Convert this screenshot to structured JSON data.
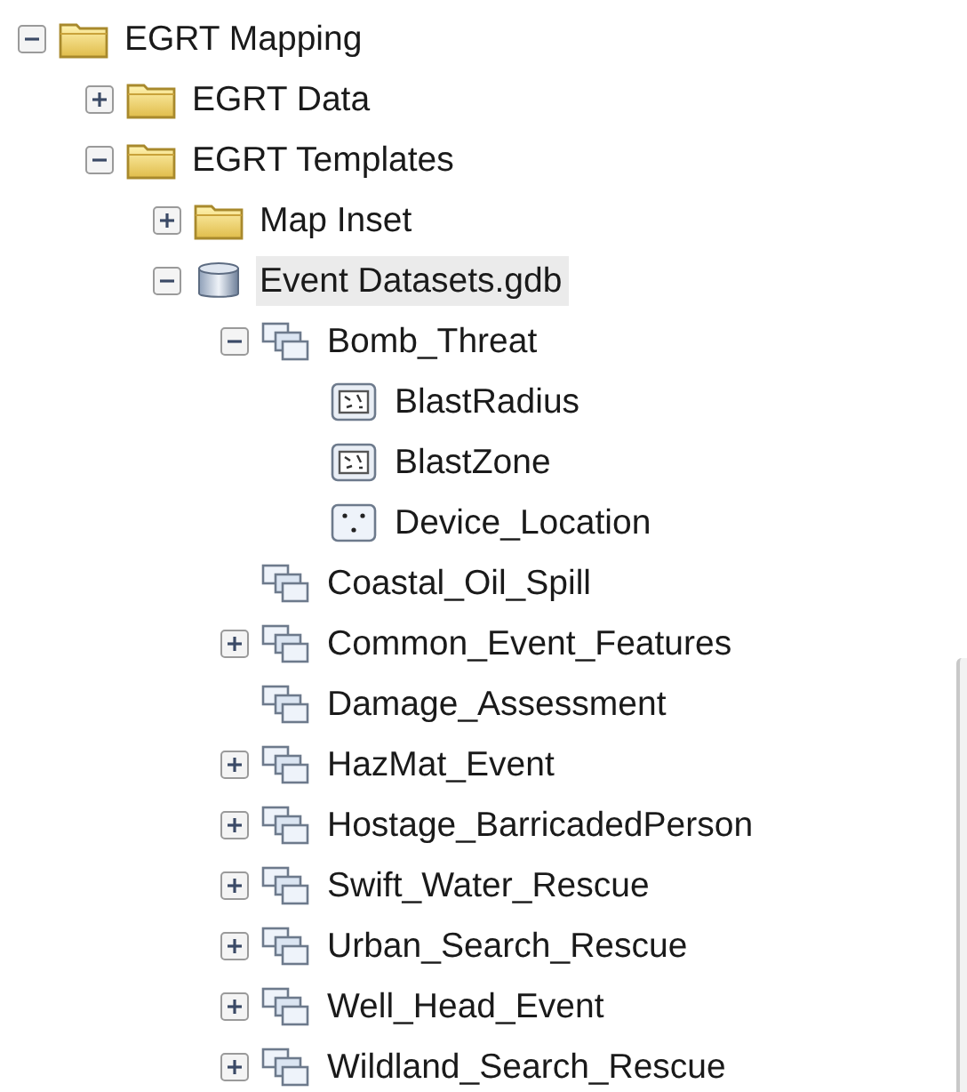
{
  "tree": [
    {
      "label": "EGRT Mapping",
      "kind": "folder",
      "expanded": true,
      "selected": false,
      "children": [
        {
          "label": "EGRT Data",
          "kind": "folder",
          "expanded": false,
          "selected": false
        },
        {
          "label": "EGRT Templates",
          "kind": "folder",
          "expanded": true,
          "selected": false,
          "children": [
            {
              "label": "Map Inset",
              "kind": "folder",
              "expanded": false,
              "selected": false
            },
            {
              "label": "Event Datasets.gdb",
              "kind": "geodatabase",
              "expanded": true,
              "selected": true,
              "children": [
                {
                  "label": "Bomb_Threat",
                  "kind": "dataset",
                  "expanded": true,
                  "selected": false,
                  "children": [
                    {
                      "label": "BlastRadius",
                      "kind": "polygon",
                      "selected": false
                    },
                    {
                      "label": "BlastZone",
                      "kind": "polygon",
                      "selected": false
                    },
                    {
                      "label": "Device_Location",
                      "kind": "point",
                      "selected": false
                    }
                  ]
                },
                {
                  "label": "Coastal_Oil_Spill",
                  "kind": "dataset",
                  "selected": false
                },
                {
                  "label": "Common_Event_Features",
                  "kind": "dataset",
                  "expanded": false,
                  "selected": false
                },
                {
                  "label": "Damage_Assessment",
                  "kind": "dataset",
                  "selected": false
                },
                {
                  "label": "HazMat_Event",
                  "kind": "dataset",
                  "expanded": false,
                  "selected": false
                },
                {
                  "label": "Hostage_BarricadedPerson",
                  "kind": "dataset",
                  "expanded": false,
                  "selected": false
                },
                {
                  "label": "Swift_Water_Rescue",
                  "kind": "dataset",
                  "expanded": false,
                  "selected": false
                },
                {
                  "label": "Urban_Search_Rescue",
                  "kind": "dataset",
                  "expanded": false,
                  "selected": false
                },
                {
                  "label": "Well_Head_Event",
                  "kind": "dataset",
                  "expanded": false,
                  "selected": false
                },
                {
                  "label": "Wildland_Search_Rescue",
                  "kind": "dataset",
                  "expanded": false,
                  "selected": false
                }
              ]
            }
          ]
        }
      ]
    }
  ]
}
